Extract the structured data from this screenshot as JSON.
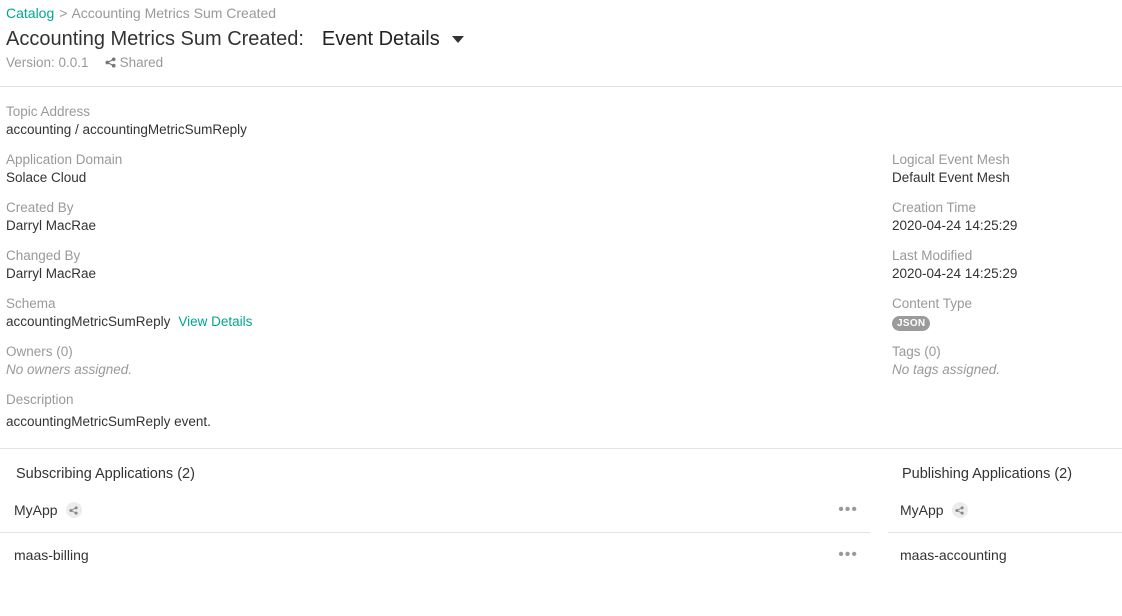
{
  "breadcrumb": {
    "root": "Catalog",
    "separator": ">",
    "current": "Accounting Metrics Sum Created"
  },
  "header": {
    "title": "Accounting Metrics Sum Created:",
    "view_selected": "Event Details",
    "version": "Version: 0.0.1",
    "shared": "Shared"
  },
  "details": {
    "topic_address": {
      "label": "Topic Address",
      "value": "accounting / accountingMetricSumReply"
    },
    "application_domain": {
      "label": "Application Domain",
      "value": "Solace Cloud"
    },
    "logical_event_mesh": {
      "label": "Logical Event Mesh",
      "value": "Default Event Mesh"
    },
    "created_by": {
      "label": "Created By",
      "value": "Darryl MacRae"
    },
    "creation_time": {
      "label": "Creation Time",
      "value": "2020-04-24 14:25:29"
    },
    "changed_by": {
      "label": "Changed By",
      "value": "Darryl MacRae"
    },
    "last_modified": {
      "label": "Last Modified",
      "value": "2020-04-24 14:25:29"
    },
    "schema": {
      "label": "Schema",
      "value": "accountingMetricSumReply",
      "link": "View Details"
    },
    "content_type": {
      "label": "Content Type",
      "value": "JSON"
    },
    "owners": {
      "label": "Owners (0)",
      "value": "No owners assigned."
    },
    "tags": {
      "label": "Tags (0)",
      "value": "No tags assigned."
    },
    "description": {
      "label": "Description",
      "value": "accountingMetricSumReply event."
    }
  },
  "subscribing": {
    "title": "Subscribing Applications (2)",
    "apps": [
      {
        "name": "MyApp",
        "shared": true,
        "more": "•••"
      },
      {
        "name": "maas-billing",
        "shared": false,
        "more": "•••"
      }
    ]
  },
  "publishing": {
    "title": "Publishing Applications (2)",
    "apps": [
      {
        "name": "MyApp",
        "shared": true
      },
      {
        "name": "maas-accounting",
        "shared": false
      }
    ]
  },
  "colors": {
    "accent": "#00A88E",
    "muted": "#999999",
    "text": "#333333",
    "divider": "#e2e2e2",
    "badge": "#9b9b9b"
  },
  "icons": {
    "share": "share-icon",
    "dropdown": "caret-down-icon",
    "more": "more-horizontal-icon"
  }
}
